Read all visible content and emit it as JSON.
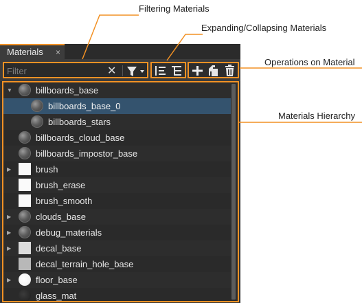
{
  "panel": {
    "tab_label": "Materials",
    "tab_close": "×",
    "filter_placeholder": "Filter",
    "filter_clear": "✕"
  },
  "callouts": {
    "filtering": "Filtering Materials",
    "expanding": "Expanding/Collapsing Materials",
    "operations": "Operations on Material",
    "hierarchy": "Materials Hierarchy"
  },
  "tree": {
    "items": [
      {
        "label": "billboards_base",
        "level": 0,
        "arrow": "expanded",
        "icon": "sphere"
      },
      {
        "label": "billboards_base_0",
        "level": 1,
        "arrow": "none",
        "icon": "sphere",
        "selected": true
      },
      {
        "label": "billboards_stars",
        "level": 1,
        "arrow": "none",
        "icon": "sphere"
      },
      {
        "label": "billboards_cloud_base",
        "level": 0,
        "arrow": "none",
        "icon": "sphere"
      },
      {
        "label": "billboards_impostor_base",
        "level": 0,
        "arrow": "none",
        "icon": "sphere"
      },
      {
        "label": "brush",
        "level": 0,
        "arrow": "collapsed",
        "icon": "square-white"
      },
      {
        "label": "brush_erase",
        "level": 0,
        "arrow": "none",
        "icon": "square-white"
      },
      {
        "label": "brush_smooth",
        "level": 0,
        "arrow": "none",
        "icon": "square-white"
      },
      {
        "label": "clouds_base",
        "level": 0,
        "arrow": "collapsed",
        "icon": "sphere"
      },
      {
        "label": "debug_materials",
        "level": 0,
        "arrow": "collapsed",
        "icon": "sphere"
      },
      {
        "label": "decal_base",
        "level": 0,
        "arrow": "collapsed",
        "icon": "square-lgray"
      },
      {
        "label": "decal_terrain_hole_base",
        "level": 0,
        "arrow": "none",
        "icon": "square-gray"
      },
      {
        "label": "floor_base",
        "level": 0,
        "arrow": "collapsed",
        "icon": "sphere-white"
      },
      {
        "label": "glass_mat",
        "level": 0,
        "arrow": "none",
        "icon": "sphere-dark"
      }
    ]
  },
  "colors": {
    "accent": "#f29124",
    "selection": "#34536e",
    "panel_bg": "#333333"
  }
}
